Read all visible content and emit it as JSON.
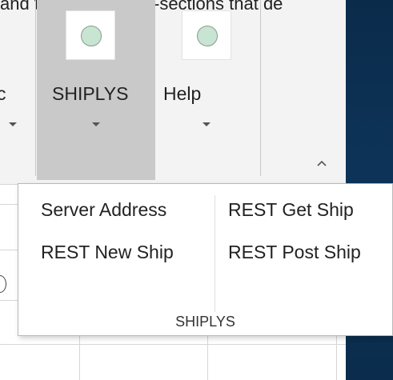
{
  "document": {
    "clipped_text": "and the set of cross-sections that de"
  },
  "ribbon": {
    "prev_button_partial_label": "c",
    "buttons": [
      {
        "label": "SHIPLYS",
        "icon": "addin-circle-icon",
        "pressed": true
      },
      {
        "label": "Help",
        "icon": "addin-circle-icon",
        "pressed": false
      }
    ],
    "collapse_icon": "chevron-up-icon"
  },
  "dropdown": {
    "left_column": [
      "Server Address",
      "REST New Ship"
    ],
    "right_column": [
      "REST Get Ship",
      "REST Post Ship"
    ],
    "group_label": "SHIPLYS"
  },
  "colors": {
    "ribbon_bg": "#f3f3f3",
    "pressed_bg": "#c9c9c9",
    "icon_fill": "#c8e4d2",
    "dark_panel": "#0d3458"
  }
}
